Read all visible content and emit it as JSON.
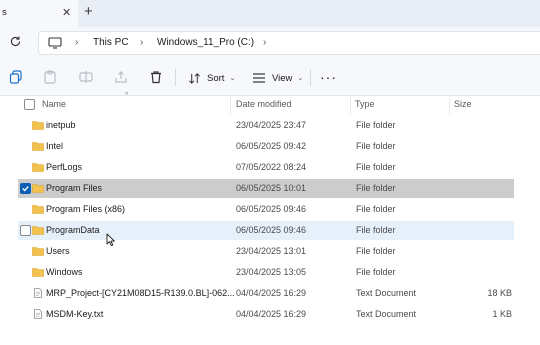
{
  "tabstrip": {
    "tab_label": "s",
    "close_glyph": "✕",
    "new_tab_glyph": "+"
  },
  "address": {
    "icon": "monitor-icon",
    "breadcrumbs": [
      "This PC",
      "Windows_11_Pro (C:)"
    ],
    "separator": "›"
  },
  "commandbar": {
    "sort_label": "Sort",
    "view_label": "View",
    "more_glyph": "···",
    "dropdown_glyph": "⌄"
  },
  "columns": {
    "name": "Name",
    "date": "Date modified",
    "type": "Type",
    "size": "Size"
  },
  "files": [
    {
      "name": "inetpub",
      "date": "23/04/2025 23:47",
      "type": "File folder",
      "size": "",
      "icon": "folder-icon",
      "state": "normal"
    },
    {
      "name": "Intel",
      "date": "06/05/2025 09:42",
      "type": "File folder",
      "size": "",
      "icon": "folder-icon",
      "state": "normal"
    },
    {
      "name": "PerfLogs",
      "date": "07/05/2022 08:24",
      "type": "File folder",
      "size": "",
      "icon": "folder-icon",
      "state": "normal"
    },
    {
      "name": "Program Files",
      "date": "06/05/2025 10:01",
      "type": "File folder",
      "size": "",
      "icon": "folder-icon",
      "state": "selected"
    },
    {
      "name": "Program Files (x86)",
      "date": "06/05/2025 09:46",
      "type": "File folder",
      "size": "",
      "icon": "folder-icon",
      "state": "normal"
    },
    {
      "name": "ProgramData",
      "date": "06/05/2025 09:46",
      "type": "File folder",
      "size": "",
      "icon": "folder-icon",
      "state": "hovered"
    },
    {
      "name": "Users",
      "date": "23/04/2025 13:01",
      "type": "File folder",
      "size": "",
      "icon": "folder-icon",
      "state": "normal"
    },
    {
      "name": "Windows",
      "date": "23/04/2025 13:05",
      "type": "File folder",
      "size": "",
      "icon": "folder-icon",
      "state": "normal"
    },
    {
      "name": "MRP_Project-[CY21M08D15-R139.0.BL]-062...",
      "date": "04/04/2025 16:29",
      "type": "Text Document",
      "size": "18 KB",
      "icon": "document-icon",
      "state": "normal"
    },
    {
      "name": "MSDM-Key.txt",
      "date": "04/04/2025 16:29",
      "type": "Text Document",
      "size": "1 KB",
      "icon": "document-icon",
      "state": "normal"
    }
  ],
  "colors": {
    "folder": "#f2c14e",
    "selected_row": "#cccccc",
    "hover_row": "#e6f0fb",
    "checkbox_accent": "#0a5fb4",
    "chrome": "#f6f8fc"
  }
}
